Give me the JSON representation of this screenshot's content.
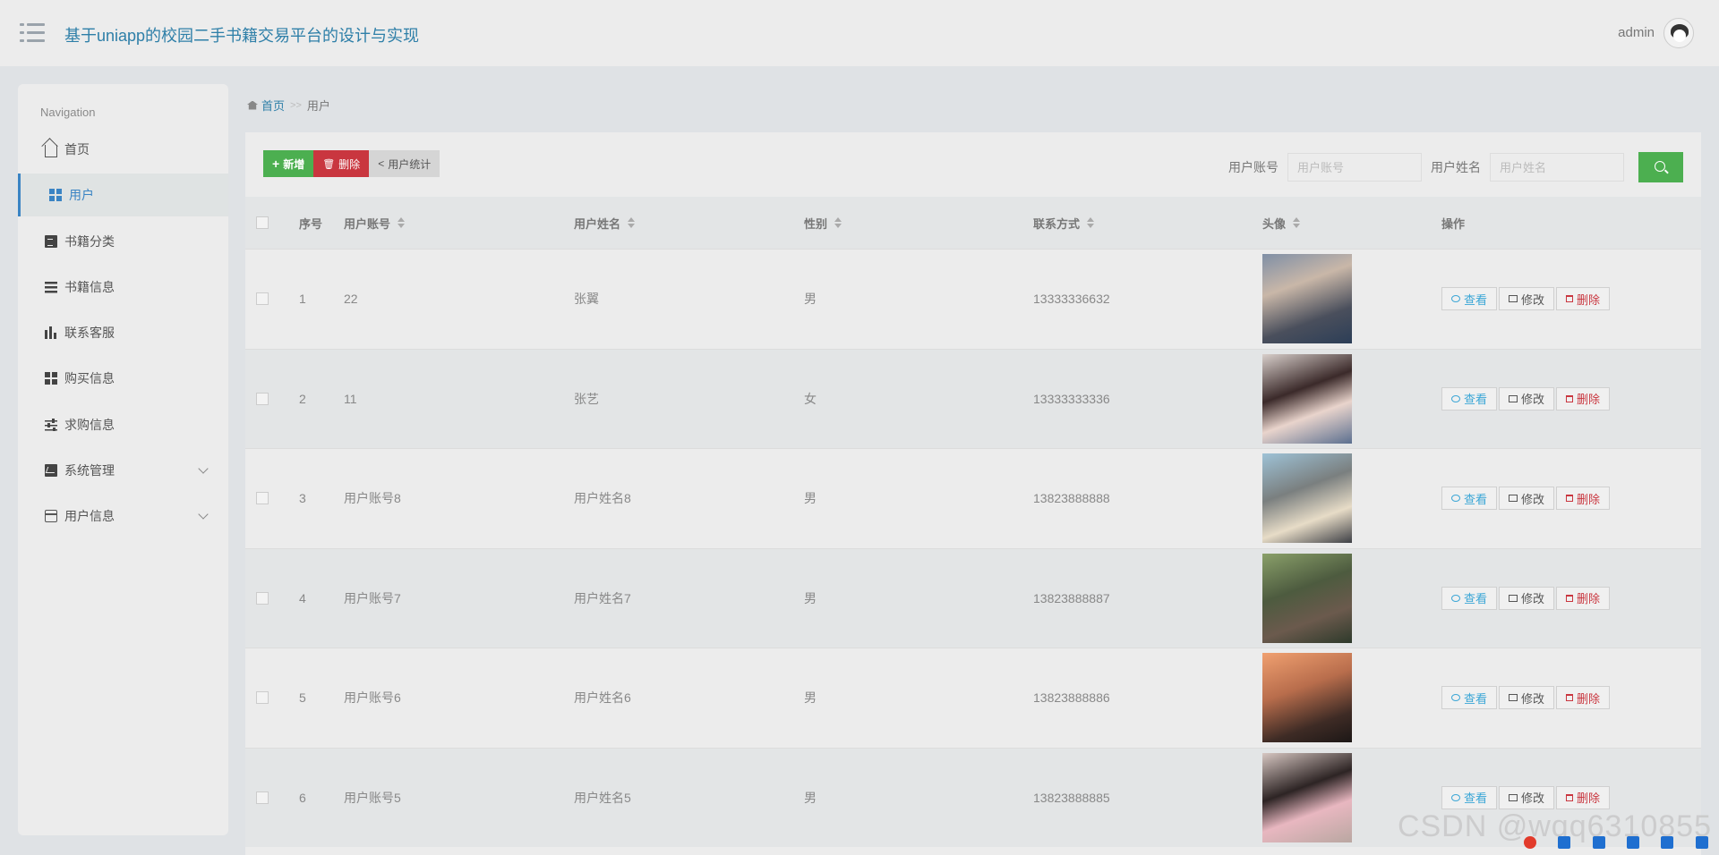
{
  "header": {
    "title": "基于uniapp的校园二手书籍交易平台的设计与实现",
    "user": "admin"
  },
  "sidebar": {
    "caption": "Navigation",
    "items": [
      {
        "label": "首页"
      },
      {
        "label": "用户"
      },
      {
        "label": "书籍分类"
      },
      {
        "label": "书籍信息"
      },
      {
        "label": "联系客服"
      },
      {
        "label": "购买信息"
      },
      {
        "label": "求购信息"
      },
      {
        "label": "系统管理"
      },
      {
        "label": "用户信息"
      }
    ]
  },
  "breadcrumb": {
    "home": "首页",
    "sep": ">>",
    "current": "用户"
  },
  "toolbar": {
    "add": "新增",
    "delete": "删除",
    "stats": "用户统计"
  },
  "search": {
    "account_label": "用户账号",
    "account_placeholder": "用户账号",
    "name_label": "用户姓名",
    "name_placeholder": "用户姓名"
  },
  "table": {
    "headers": [
      "序号",
      "用户账号",
      "用户姓名",
      "性别",
      "联系方式",
      "头像",
      "操作"
    ],
    "rows": [
      {
        "no": "1",
        "account": "22",
        "name": "张翼",
        "gender": "男",
        "phone": "13333336632"
      },
      {
        "no": "2",
        "account": "11",
        "name": "张艺",
        "gender": "女",
        "phone": "13333333336"
      },
      {
        "no": "3",
        "account": "用户账号8",
        "name": "用户姓名8",
        "gender": "男",
        "phone": "13823888888"
      },
      {
        "no": "4",
        "account": "用户账号7",
        "name": "用户姓名7",
        "gender": "男",
        "phone": "13823888887"
      },
      {
        "no": "5",
        "account": "用户账号6",
        "name": "用户姓名6",
        "gender": "男",
        "phone": "13823888886"
      },
      {
        "no": "6",
        "account": "用户账号5",
        "name": "用户姓名5",
        "gender": "男",
        "phone": "13823888885"
      }
    ],
    "actions": {
      "view": "查看",
      "edit": "修改",
      "delete": "删除"
    }
  },
  "watermark": "CSDN @wqq6310855",
  "colors": {
    "accent": "#3a84c4",
    "success": "#4caf50",
    "danger": "#c9363f"
  }
}
